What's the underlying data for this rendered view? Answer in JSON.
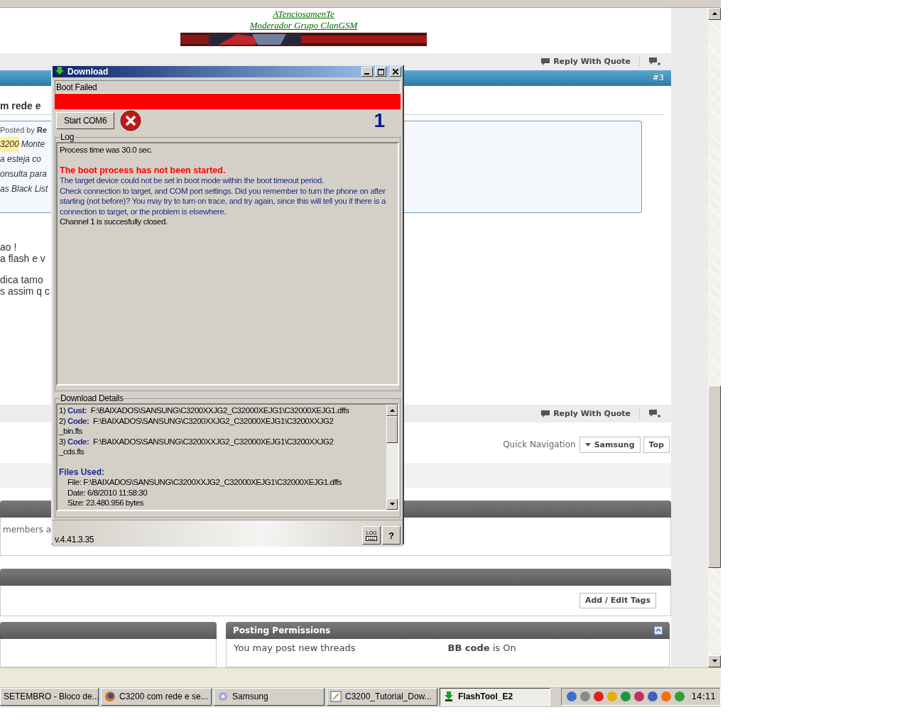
{
  "signature": {
    "line1": "ATenciosamenTe",
    "line2": "Moderador Grupo ClanGSM"
  },
  "top_post_bar": {
    "reply": "Reply With Quote"
  },
  "post": {
    "number": "#3",
    "title": "m rede e",
    "posted_by": "Posted by",
    "author": "Re",
    "quote_lines": [
      {
        "highlight": "3200",
        "text": "Monte"
      },
      {
        "text": "a esteja co"
      },
      {
        "text": "onsulta para"
      },
      {
        "text": "as Black List"
      }
    ],
    "paragraphs": [
      [
        "ao !",
        "a flash e v"
      ],
      [
        "dica tamo",
        "s assim q c"
      ]
    ]
  },
  "bottom_post_bar": {
    "reply": "Reply With Quote"
  },
  "quick_navigation": {
    "label": "Quick Navigation",
    "menu": "Samsung",
    "top": "Top"
  },
  "online_panel": {
    "text": "members a"
  },
  "tags_panel": {
    "button": "Add / Edit Tags"
  },
  "posting_permissions": {
    "title": "Posting Permissions",
    "left": [
      "You may post new threads"
    ],
    "right": [
      "**BB code** is On"
    ]
  },
  "dialog": {
    "title": "Download",
    "status": "Boot Failed",
    "progress": {
      "level": 1,
      "failed": true
    },
    "start_button": "Start COM6",
    "counter": "1",
    "log_label": "Log",
    "log": [
      [
        {
          "kind": "normal",
          "text": "Process time was 30.0 sec."
        }
      ],
      [
        {
          "kind": "error",
          "text": "The boot process has not been started."
        },
        {
          "kind": "info",
          "text": "The target device could not be set in boot mode within the boot timeout period."
        },
        {
          "kind": "info",
          "text": "Check connection to target, and COM port settings. Did you remember to turn the phone on after starting (not before)? You may try to turn on trace, and try again, since this will tell you if there is a connection to target, or the problem is elsewhere."
        },
        {
          "kind": "normal",
          "text": "Channel 1 is succesfully closed."
        }
      ]
    ],
    "details_label": "Download Details",
    "details": [
      {
        "index": "1)",
        "label": "Cust:",
        "path": "F:\\BAIXADOS\\SANSUNG\\C3200XXJG2_C32000XEJG1\\C32000XEJG1.dffs"
      },
      {
        "index": "2)",
        "label": "Code:",
        "path": "F:\\BAIXADOS\\SANSUNG\\C3200XXJG2_C32000XEJG1\\C3200XXJG2",
        "continued": "_bin.fls"
      },
      {
        "index": "3)",
        "label": "Code:",
        "path": "F:\\BAIXADOS\\SANSUNG\\C3200XXJG2_C32000XEJG1\\C3200XXJG2",
        "continued": "_cds.fls"
      }
    ],
    "files_used": {
      "title": "Files Used:",
      "lines": [
        "File: F:\\BAIXADOS\\SANSUNG\\C3200XXJG2_C32000XEJG1\\C32000XEJG1.dffs",
        "Date: 6/8/2010 11:58:30",
        "Size: 23.480.956 bytes"
      ]
    },
    "version": "v.4.41.3.35",
    "log_button": "LOG",
    "help_button": "?"
  },
  "taskbar": {
    "items": [
      {
        "label": "SETEMBRO - Bloco de...",
        "kind": "notepad",
        "selected": false
      },
      {
        "label": "C3200 com rede e se...",
        "kind": "browser",
        "selected": false
      },
      {
        "label": "Samsung",
        "kind": "folder",
        "selected": false
      },
      {
        "label": "C3200_Tutorial_Dow...",
        "kind": "editor",
        "selected": false
      },
      {
        "label": "FlashTool_E2",
        "kind": "flash",
        "selected": true
      }
    ],
    "clock": "14:11"
  }
}
